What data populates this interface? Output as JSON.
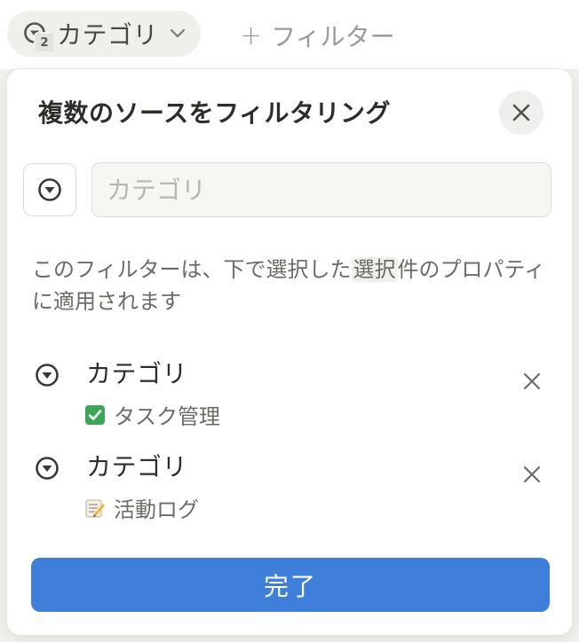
{
  "filter_bar": {
    "chip_label": "カテゴリ",
    "chip_badge": "2",
    "add_filter_plus": "+",
    "add_filter_label": "フィルター"
  },
  "popover": {
    "title": "複数のソースをフィルタリング",
    "name_input": {
      "value": "",
      "placeholder": "カテゴリ"
    },
    "description": {
      "before": "このフィルターは、下で選択した",
      "highlight": "選択",
      "after": "件のプロパティに適用されます"
    },
    "sources": [
      {
        "property": "カテゴリ",
        "database": "タスク管理",
        "emoji": "check-box-icon"
      },
      {
        "property": "カテゴリ",
        "database": "活動ログ",
        "emoji": "memo-icon"
      }
    ],
    "done_label": "完了"
  },
  "colors": {
    "accent": "#3f7fd9",
    "text_primary": "#2f2d29",
    "text_secondary": "#6d6b66",
    "check_green": "#3aa757"
  }
}
